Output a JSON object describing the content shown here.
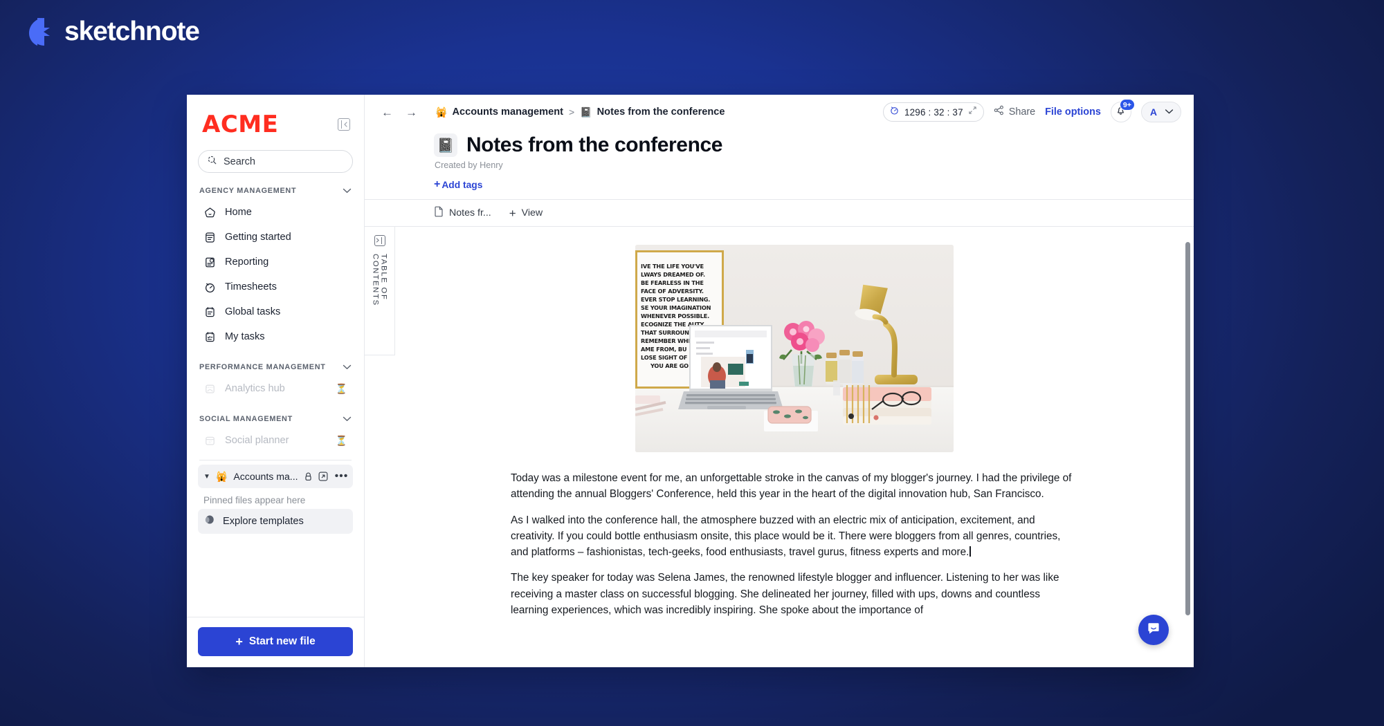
{
  "brand": {
    "name": "sketchnote",
    "logo_icon": "lightning-bolt-icon",
    "accent": "#4a6cf7"
  },
  "sidebar": {
    "workspace_logo": "ACME",
    "collapse_icon": "panel-collapse-icon",
    "search": {
      "placeholder": "Search",
      "icon": "search-icon"
    },
    "sections": [
      {
        "label": "AGENCY MANAGEMENT",
        "chevron": "chevron-down-icon",
        "items": [
          {
            "label": "Home",
            "icon": "home-icon",
            "disabled": false
          },
          {
            "label": "Getting started",
            "icon": "book-icon",
            "disabled": false
          },
          {
            "label": "Reporting",
            "icon": "report-icon",
            "disabled": false
          },
          {
            "label": "Timesheets",
            "icon": "stopwatch-icon",
            "disabled": false
          },
          {
            "label": "Global tasks",
            "icon": "clipboard-icon",
            "disabled": false
          },
          {
            "label": "My tasks",
            "icon": "checklist-icon",
            "disabled": false
          }
        ]
      },
      {
        "label": "PERFORMANCE MANAGEMENT",
        "chevron": "chevron-down-icon",
        "items": [
          {
            "label": "Analytics hub",
            "icon": "analytics-icon",
            "disabled": true,
            "badge": "⏳"
          }
        ]
      },
      {
        "label": "SOCIAL MANAGEMENT",
        "chevron": "chevron-down-icon",
        "items": [
          {
            "label": "Social planner",
            "icon": "calendar-icon",
            "disabled": true,
            "badge": "⏳"
          }
        ]
      }
    ],
    "workspace_row": {
      "caret": "caret-down-icon",
      "emoji": "🙀",
      "name": "Accounts ma...",
      "lock_icon": "lock-icon",
      "open_icon": "external-link-icon",
      "more_icon": "more-dots-icon"
    },
    "pinned_hint": "Pinned files appear here",
    "explore_templates": {
      "label": "Explore templates",
      "icon": "templates-icon"
    },
    "start_new_file": {
      "label": "Start new file",
      "plus": "+",
      "color": "#2b44d4"
    }
  },
  "topbar": {
    "back_arrow": "←",
    "forward_arrow": "→",
    "breadcrumb": [
      {
        "emoji": "🙀",
        "label": "Accounts management"
      },
      {
        "emoji": "📓",
        "label": "Notes from the conference"
      }
    ],
    "separator": ">",
    "timer": {
      "icon": "stopwatch-icon",
      "value": "1296 : 32 : 37",
      "expand_icon": "expand-icon"
    },
    "share": {
      "label": "Share",
      "icon": "share-icon"
    },
    "file_options": "File options",
    "notifications": {
      "icon": "bell-icon",
      "badge": "9+"
    },
    "avatar": {
      "initial": "A",
      "chevron": "chevron-down-icon"
    }
  },
  "document": {
    "emoji": "📓",
    "title": "Notes from the conference",
    "created_by": "Created by Henry",
    "add_tags": {
      "plus": "+",
      "label": "Add tags"
    },
    "tabs": [
      {
        "label": "Notes fr...",
        "icon": "file-icon"
      },
      {
        "label": "View",
        "icon": "plus-icon"
      }
    ],
    "toc_label": "TABLE OF CONTENTS",
    "toc_icon": "panel-expand-icon",
    "hero_image": {
      "alt": "desk-photo",
      "poster_lines": [
        "IVE THE LIFE YOU'VE",
        "LWAYS  DREAMED OF.",
        "BE FEARLESS IN THE",
        "FACE OF ADVERSITY.",
        "EVER STOP LEARNING.",
        "SE YOUR IMAGINATION",
        "WHENEVER POSSIBLE.",
        "ECOGNIZE THE    AUTY",
        "THAT SURROUND",
        "REMEMBER WHI",
        "AME FROM, BU",
        "LOSE SIGHT OF",
        "YOU ARE GO"
      ]
    },
    "paragraphs": [
      "Today was a milestone event for me, an unforgettable stroke in the canvas of my blogger's journey. I had the privilege of attending the annual Bloggers' Conference, held this year in the heart of the digital innovation hub, San Francisco.",
      "As I walked into the conference hall, the atmosphere buzzed with an electric mix of anticipation, excitement, and creativity. If you could bottle enthusiasm onsite, this place would be it. There were bloggers from all genres, countries, and platforms – fashionistas, tech-geeks, food enthusiasts, travel gurus, fitness experts and more.",
      "The key speaker for today was Selena James, the renowned lifestyle blogger and influencer. Listening to her was like receiving a master class on successful blogging. She delineated her journey, filled with ups, downs and countless learning experiences, which was incredibly inspiring. She spoke about the importance of"
    ]
  },
  "support_widget": {
    "icon": "chat-bubble-icon",
    "color": "#2b44d4"
  }
}
